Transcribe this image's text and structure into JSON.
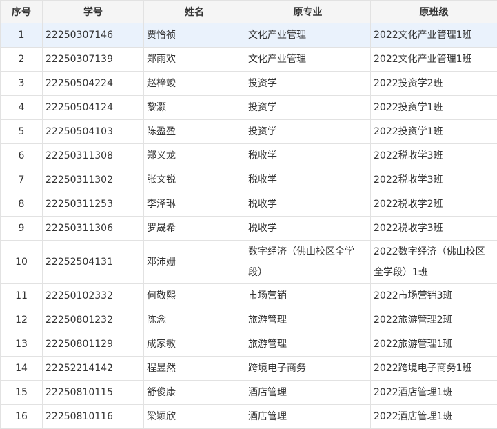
{
  "table": {
    "headers": [
      "序号",
      "学号",
      "姓名",
      "原专业",
      "原班级"
    ],
    "rows": [
      [
        "1",
        "22250307146",
        "贾怡祯",
        "文化产业管理",
        "2022文化产业管理1班"
      ],
      [
        "2",
        "22250307139",
        "郑雨欢",
        "文化产业管理",
        "2022文化产业管理1班"
      ],
      [
        "3",
        "22250504224",
        "赵梓竣",
        "投资学",
        "2022投资学2班"
      ],
      [
        "4",
        "22250504124",
        "黎灏",
        "投资学",
        "2022投资学1班"
      ],
      [
        "5",
        "22250504103",
        "陈盈盈",
        "投资学",
        "2022投资学1班"
      ],
      [
        "6",
        "22250311308",
        "郑义龙",
        "税收学",
        "2022税收学3班"
      ],
      [
        "7",
        "22250311302",
        "张文锐",
        "税收学",
        "2022税收学3班"
      ],
      [
        "8",
        "22250311253",
        "李泽琳",
        "税收学",
        "2022税收学2班"
      ],
      [
        "9",
        "22250311306",
        "罗晟希",
        "税收学",
        "2022税收学3班"
      ],
      [
        "10",
        "22252504131",
        "邓沛姗",
        "数字经济（佛山校区全学段）",
        "2022数字经济（佛山校区全学段）1班"
      ],
      [
        "11",
        "22250102332",
        "何敬熙",
        "市场营销",
        "2022市场营销3班"
      ],
      [
        "12",
        "22250801232",
        "陈念",
        "旅游管理",
        "2022旅游管理2班"
      ],
      [
        "13",
        "22250801129",
        "成家敏",
        "旅游管理",
        "2022旅游管理1班"
      ],
      [
        "14",
        "22252214142",
        "程昱然",
        "跨境电子商务",
        "2022跨境电子商务1班"
      ],
      [
        "15",
        "22250810115",
        "舒俊康",
        "酒店管理",
        "2022酒店管理1班"
      ],
      [
        "16",
        "22250810116",
        "梁颖欣",
        "酒店管理",
        "2022酒店管理1班"
      ]
    ]
  }
}
